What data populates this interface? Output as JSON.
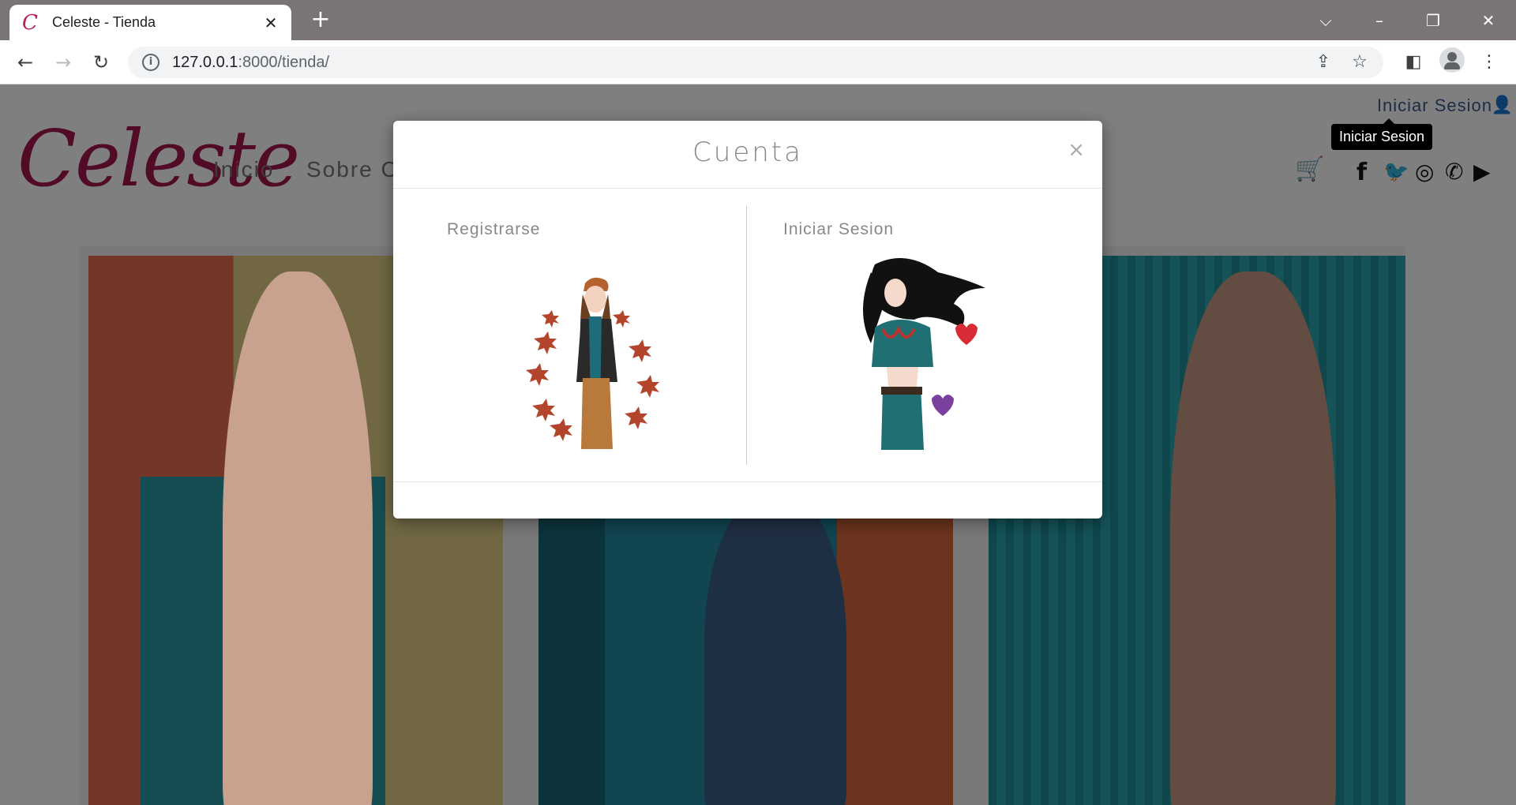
{
  "browser": {
    "tab_title": "Celeste - Tienda",
    "tab_favicon": "C",
    "url_host": "127.0.0.1",
    "url_path": ":8000/tienda/"
  },
  "site": {
    "logo": "Celeste",
    "nav": [
      "Inicio",
      "Sobre C"
    ],
    "login_link": "Iniciar Sesion",
    "tooltip": "Iniciar Sesion"
  },
  "modal": {
    "title": "Cuenta",
    "close": "×",
    "register_label": "Registrarse",
    "login_label": "Iniciar Sesion"
  },
  "icons": {
    "social": [
      "facebook-icon",
      "twitter-icon",
      "instagram-icon",
      "whatsapp-icon",
      "youtube-icon"
    ]
  },
  "colors": {
    "brand": "#a3174f",
    "link": "#3a5a8a"
  }
}
